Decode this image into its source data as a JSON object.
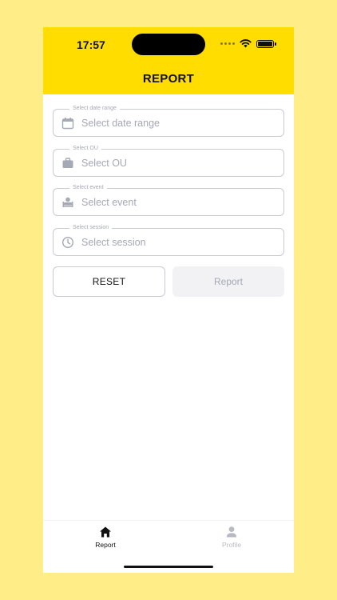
{
  "status_bar": {
    "time": "17:57"
  },
  "header": {
    "title": "REPORT"
  },
  "form": {
    "fields": [
      {
        "legend": "Select date range",
        "placeholder": "Select date range",
        "icon": "calendar-icon"
      },
      {
        "legend": "Select OU",
        "placeholder": "Select OU",
        "icon": "briefcase-icon"
      },
      {
        "legend": "Select event",
        "placeholder": "Select event",
        "icon": "event-icon"
      },
      {
        "legend": "Select session",
        "placeholder": "Select session",
        "icon": "clock-icon"
      }
    ],
    "reset_label": "RESET",
    "report_label": "Report"
  },
  "tabbar": {
    "items": [
      {
        "label": "Report",
        "icon": "home-icon",
        "active": true
      },
      {
        "label": "Profile",
        "icon": "person-icon",
        "active": false
      }
    ]
  },
  "colors": {
    "background": "#FFEE88",
    "header": "#FFDD00",
    "placeholder": "#A5A8B5",
    "border": "#C9CBD3",
    "disabled_button": "#F2F2F4"
  }
}
